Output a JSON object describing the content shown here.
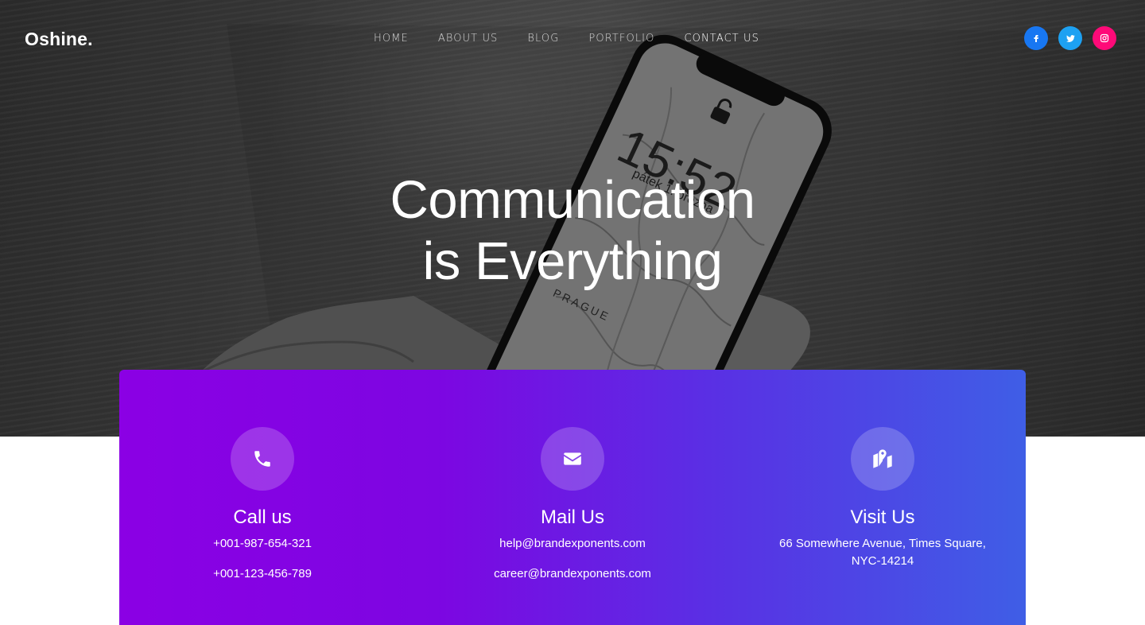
{
  "brand": {
    "logo": "Oshine."
  },
  "nav": {
    "items": [
      {
        "label": "HOME"
      },
      {
        "label": "ABOUT US"
      },
      {
        "label": "BLOG"
      },
      {
        "label": "PORTFOLIO"
      },
      {
        "label": "CONTACT US"
      }
    ],
    "active": "CONTACT US"
  },
  "social": {
    "facebook": {
      "icon": "facebook-icon",
      "glyph": "f",
      "color": "#1877f2"
    },
    "twitter": {
      "icon": "twitter-icon",
      "glyph": "t",
      "color": "#1da1f2"
    },
    "instagram": {
      "icon": "instagram-icon",
      "glyph": "ig",
      "color": "#ff0a78"
    }
  },
  "hero": {
    "title_line1": "Communication",
    "title_line2": "is Everything",
    "phone_time": "15:52",
    "phone_date": "pátek 1. března",
    "phone_city": "PRAGUE"
  },
  "contact": {
    "gradient": {
      "start": "#8b00e4",
      "end": "#3f5ee6"
    },
    "call": {
      "icon": "phone-icon",
      "title": "Call us",
      "line1": "+001-987-654-321",
      "line2": "+001-123-456-789"
    },
    "mail": {
      "icon": "envelope-icon",
      "title": "Mail Us",
      "line1": "help@brandexponents.com",
      "line2": "career@brandexponents.com"
    },
    "visit": {
      "icon": "map-marker-icon",
      "title": "Visit Us",
      "line1": "66 Somewhere Avenue, Times Square,",
      "line2": "NYC-14214"
    }
  }
}
